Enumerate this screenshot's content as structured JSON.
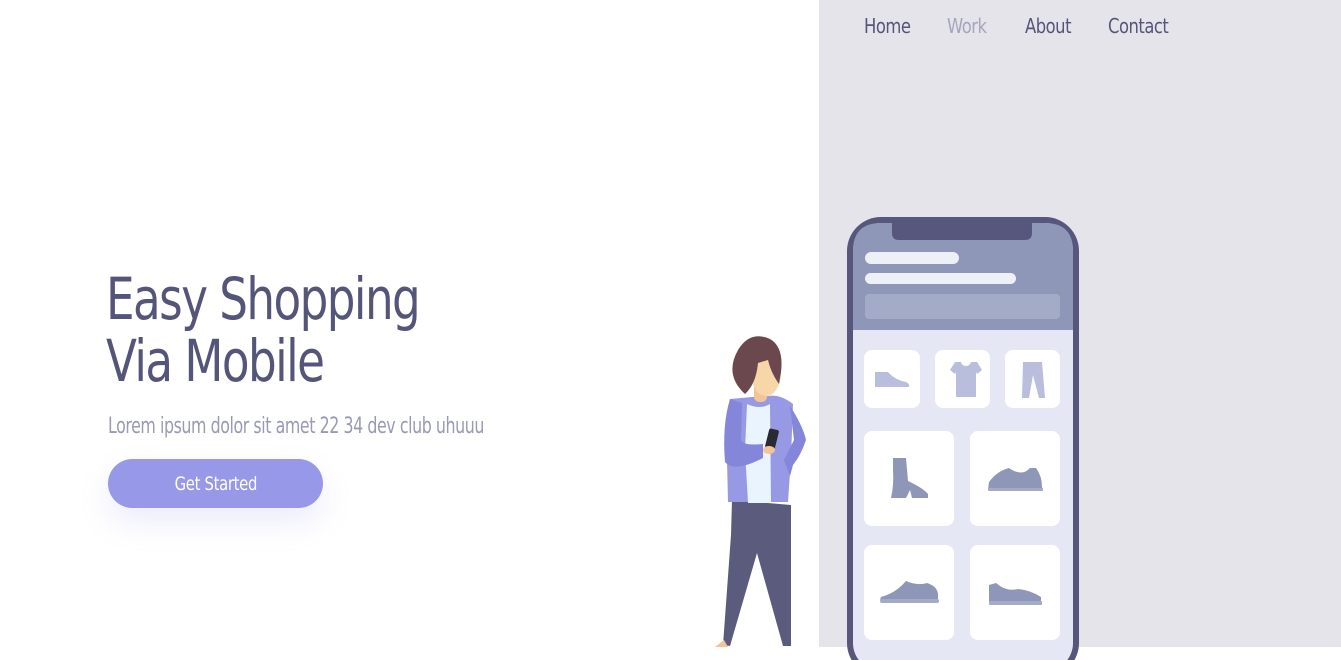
{
  "nav": {
    "items": [
      {
        "label": "Home",
        "active": false
      },
      {
        "label": "Work",
        "active": true
      },
      {
        "label": "About",
        "active": false
      },
      {
        "label": "Contact",
        "active": false
      }
    ]
  },
  "hero": {
    "title_line1": "Easy Shopping",
    "title_line2": "Via Mobile",
    "subtitle": "Lorem ipsum dolor sit amet 22 34 dev club uhuuu",
    "cta_label": "Get Started"
  },
  "illustration": {
    "phone_tiles_small": [
      "flat-shoe-icon",
      "tshirt-icon",
      "pants-icon"
    ],
    "phone_tiles_large": [
      "ankle-boot-icon",
      "sneaker-icon",
      "low-shoe-icon",
      "slip-on-shoe-icon"
    ]
  },
  "colors": {
    "accent": "#9798e8",
    "text_dark": "#55557a",
    "text_muted": "#9a9ab4",
    "nav_active": "#a5a5bf",
    "panel_bg": "#e5e4ea",
    "phone_frame": "#57577e",
    "phone_header": "#8f97b8"
  }
}
